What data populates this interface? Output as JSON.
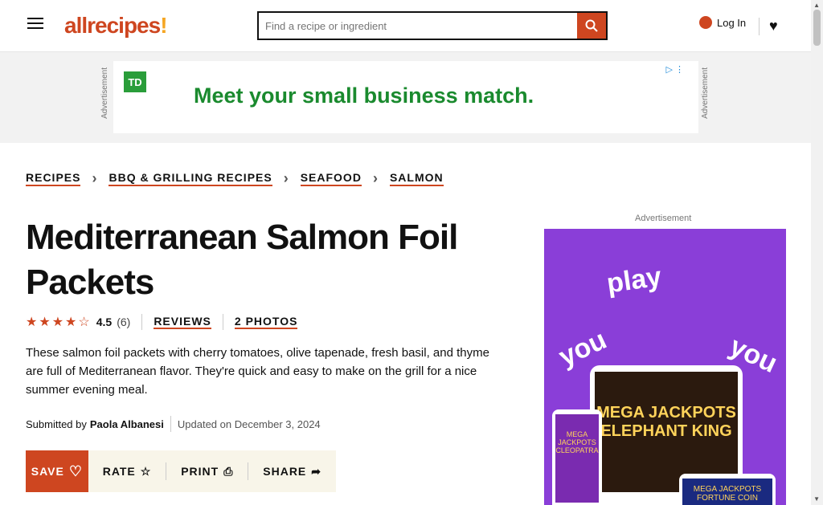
{
  "header": {
    "logo_text": "allrecipes",
    "search_placeholder": "Find a recipe or ingredient",
    "login_label": "Log In"
  },
  "ad_banner": {
    "label": "Advertisement",
    "brand": "TD",
    "headline": "Meet your small business match."
  },
  "breadcrumbs": [
    "RECIPES",
    "BBQ & GRILLING RECIPES",
    "SEAFOOD",
    "SALMON"
  ],
  "recipe": {
    "title": "Mediterranean Salmon Foil Packets",
    "rating_value": "4.5",
    "rating_stars": 4.5,
    "rating_count": "(6)",
    "reviews_label": "REVIEWS",
    "photos_label": "2 PHOTOS",
    "description": "These salmon foil packets with cherry tomatoes, olive tapenade, fresh basil, and thyme are full of Mediterranean flavor. They're quick and easy to make on the grill for a nice summer evening meal.",
    "submitted_prefix": "Submitted by",
    "author": "Paola Albanesi",
    "updated": "Updated on December 3, 2024"
  },
  "actions": {
    "save": "SAVE",
    "rate": "RATE",
    "print": "PRINT",
    "share": "SHARE"
  },
  "side_ad": {
    "label": "Advertisement",
    "word1": "play",
    "word2": "you",
    "word3": "you",
    "game1": "MEGA JACKPOTS ELEPHANT KING",
    "game2": "MEGA JACKPOTS CLEOPATRA",
    "game3": "MEGA JACKPOTS FORTUNE COIN"
  },
  "colors": {
    "brand": "#ce4620",
    "ad_green": "#1a8a2e",
    "side_ad_bg": "#8a3ed8"
  }
}
